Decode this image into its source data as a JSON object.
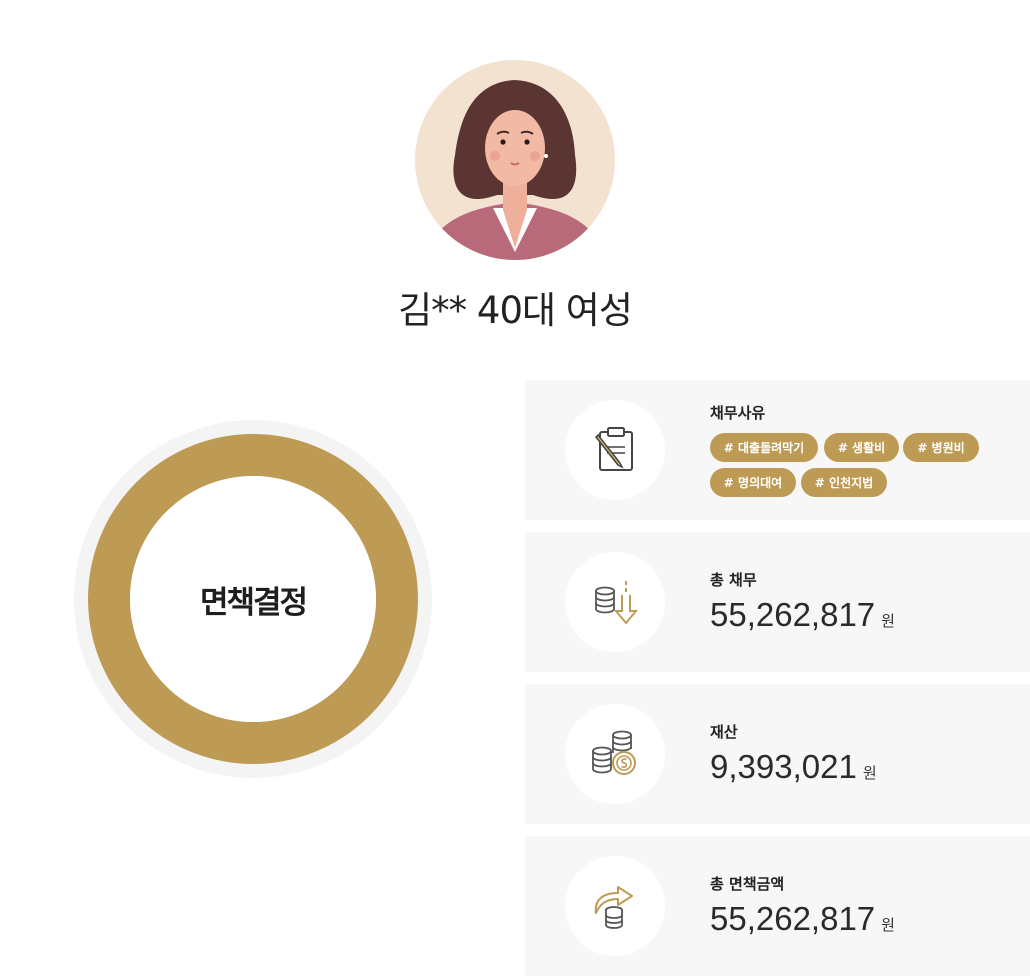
{
  "profile": {
    "name": "김**",
    "age_group": "40대",
    "gender": "여성"
  },
  "result": {
    "label": "면책결정"
  },
  "colors": {
    "accent": "#be9b55",
    "card_bg": "#f7f7f7",
    "ring_outer": "#f4f4f4"
  },
  "cards": {
    "debt_reason": {
      "label": "채무사유",
      "icon": "clipboard-pencil-icon",
      "tags": [
        "# 대출돌려막기",
        "# 생활비",
        "# 병원비",
        "# 명의대여",
        "# 인천지법"
      ]
    },
    "total_debt": {
      "label": "총 채무",
      "icon": "coins-down-arrow-icon",
      "value": "55,262,817",
      "unit": "원"
    },
    "assets": {
      "label": "재산",
      "icon": "coin-stacks-icon",
      "value": "9,393,021",
      "unit": "원"
    },
    "total_exemption": {
      "label": "총 면책금액",
      "icon": "coins-exchange-arrow-icon",
      "value": "55,262,817",
      "unit": "원"
    }
  }
}
